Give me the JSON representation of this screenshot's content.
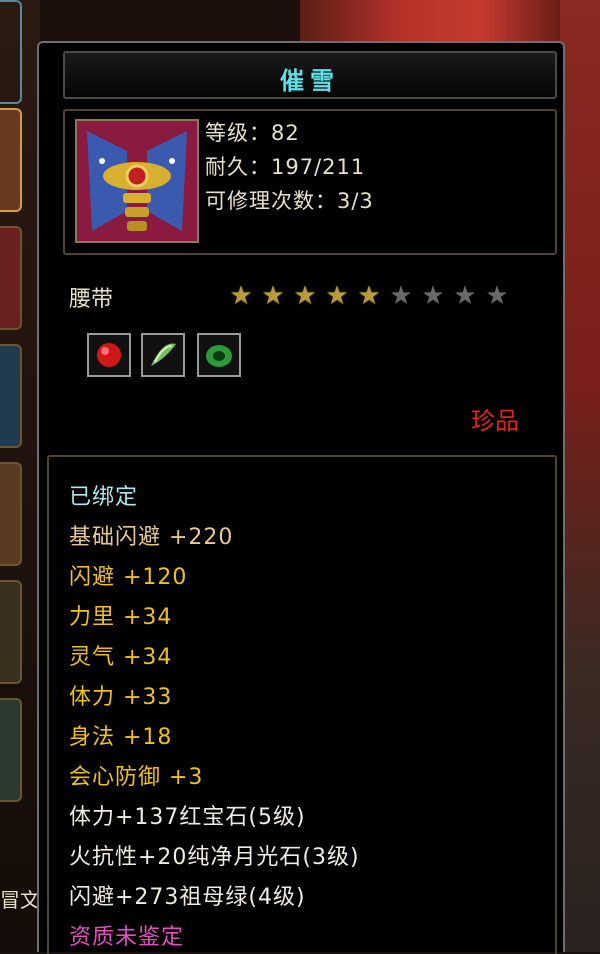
{
  "item": {
    "name": "催雪",
    "level": "等级：82",
    "durability": "耐久：197/211",
    "repairs": "可修理次数：3/3",
    "slot": "腰带",
    "stars_filled": 5,
    "stars_total": 9,
    "rarity": "珍品"
  },
  "gems": [
    {
      "icon": "ruby-gem-icon",
      "color": "#d01818"
    },
    {
      "icon": "moonstone-gem-icon",
      "color": "#7ac060"
    },
    {
      "icon": "emerald-gem-icon",
      "color": "#2a9a3a"
    }
  ],
  "stats": {
    "bound": "已绑定",
    "base_dodge": "基础闪避  +220",
    "dodge": "闪避  +120",
    "strength": "力里  +34",
    "spirit": "灵气  +34",
    "stamina": "体力  +33",
    "agility": "身法  +18",
    "crit_defense": "会心防御  +3",
    "gem_ruby": "体力+137红宝石(5级)",
    "gem_moonstone": "火抗性+20纯净月光石(3级)",
    "gem_emerald": "闪避+273祖母绿(4级)",
    "quality": "资质未鉴定"
  },
  "background": {
    "partial_text": "冒文"
  }
}
